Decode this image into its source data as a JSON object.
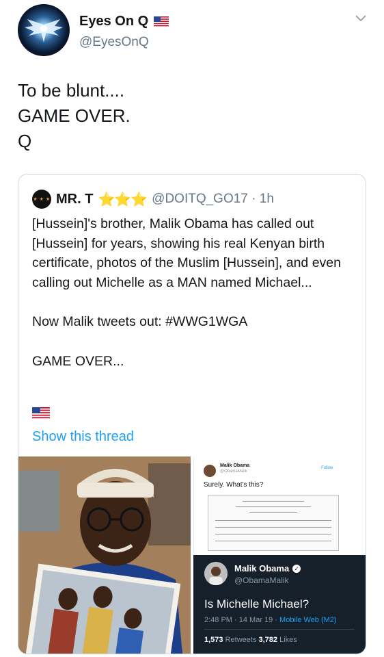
{
  "author": {
    "name": "Eyes On Q",
    "handle": "@EyesOnQ"
  },
  "tweet": {
    "lines": [
      "To be blunt....",
      "GAME OVER.",
      "Q"
    ]
  },
  "quoted": {
    "avatar_text": "★ ★ ★",
    "name": "MR. T",
    "stars": "⭐⭐⭐",
    "meta": "@DOITQ_GO17 · 1h",
    "para1": "[Hussein]'s brother, Malik Obama has called out [Hussein] for years, showing his real Kenyan birth certificate, photos of the Muslim [Hussein], and even calling out Michelle as a MAN named Michael...",
    "para2": "Now Malik tweets out: #WWG1WGA",
    "para3": "GAME OVER...",
    "show_thread": "Show this thread"
  },
  "media": {
    "embedded_top": {
      "name": "Malik Obama",
      "handle": "@ObamaMalik",
      "follow": "Follow",
      "text": "Surely. What's this?"
    },
    "embedded_bottom": {
      "name": "Malik Obama",
      "handle": "@ObamaMalik",
      "text": "Is Michelle Michael?",
      "time": "2:48 PM · 14 Mar 19 · ",
      "source": "Mobile Web (M2)",
      "retweets_count": "1,573",
      "retweets_label": " Retweets ",
      "likes_count": "3,782",
      "likes_label": " Likes"
    }
  },
  "colors": {
    "link": "#1da1f2",
    "secondary_text": "#657786",
    "dark_card": "#15202b"
  }
}
